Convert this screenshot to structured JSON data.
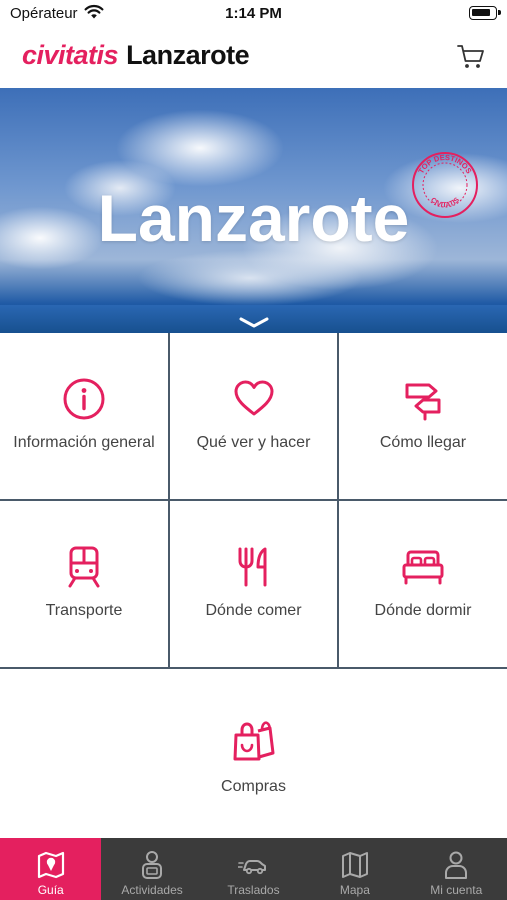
{
  "status_bar": {
    "carrier": "Opérateur",
    "time": "1:14 PM"
  },
  "header": {
    "logo": "civitatis",
    "destination": "Lanzarote",
    "cart_icon": "cart-icon"
  },
  "hero": {
    "title": "Lanzarote",
    "badge_top": "TOP DESTINOS",
    "badge_bottom": "CIVITATIS",
    "scroll_icon": "chevron-down-icon"
  },
  "menu": {
    "items": [
      {
        "label": "Información general",
        "icon": "info-icon"
      },
      {
        "label": "Qué ver y hacer",
        "icon": "heart-icon"
      },
      {
        "label": "Cómo llegar",
        "icon": "signpost-icon"
      },
      {
        "label": "Transporte",
        "icon": "train-icon"
      },
      {
        "label": "Dónde comer",
        "icon": "fork-knife-icon"
      },
      {
        "label": "Dónde dormir",
        "icon": "bed-icon"
      },
      {
        "label": "Compras",
        "icon": "shopping-bags-icon"
      }
    ]
  },
  "tabbar": {
    "tabs": [
      {
        "label": "Guía",
        "icon": "map-pin-icon",
        "active": true
      },
      {
        "label": "Actividades",
        "icon": "guide-person-icon",
        "active": false
      },
      {
        "label": "Traslados",
        "icon": "car-icon",
        "active": false
      },
      {
        "label": "Mapa",
        "icon": "map-icon",
        "active": false
      },
      {
        "label": "Mi cuenta",
        "icon": "user-icon",
        "active": false
      }
    ]
  },
  "colors": {
    "accent": "#e4205f",
    "tabbar_bg": "#3b3b3b",
    "tab_inactive": "#a9a9a9"
  }
}
